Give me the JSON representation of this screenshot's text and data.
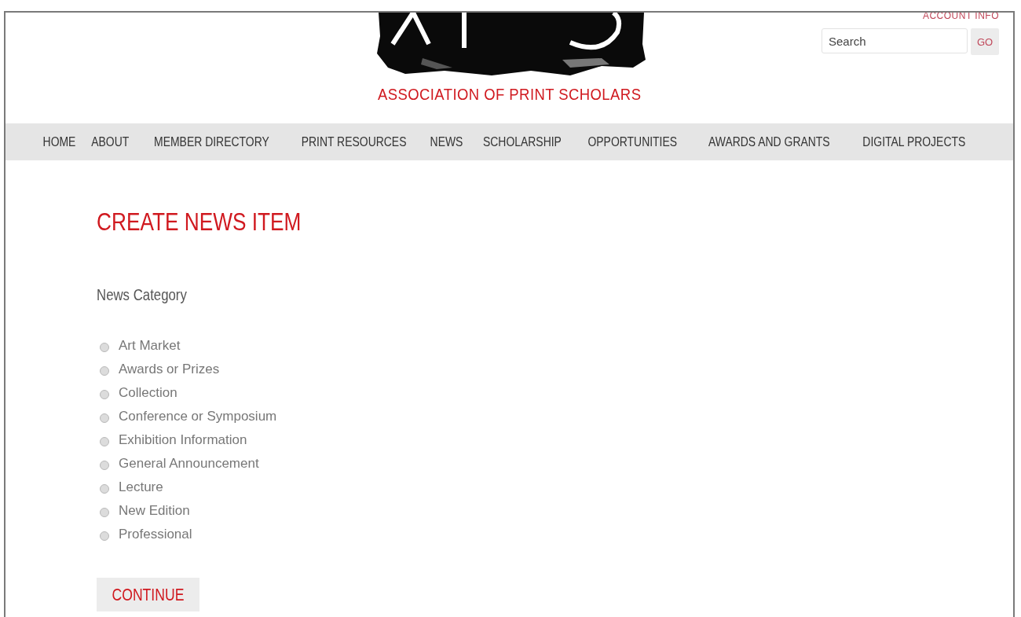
{
  "header": {
    "logo_caption": "ASSOCIATION OF PRINT SCHOLARS",
    "account_link": "ACCOUNT INFO",
    "search": {
      "placeholder": "Search",
      "button": "GO"
    }
  },
  "nav": [
    {
      "label": "HOME",
      "selected": false
    },
    {
      "label": "ABOUT",
      "selected": false
    },
    {
      "label": "MEMBER DIRECTORY",
      "selected": false
    },
    {
      "label": "PRINT RESOURCES",
      "selected": false
    },
    {
      "label": "NEWS",
      "selected": false
    },
    {
      "label": "SCHOLARSHIP",
      "selected": false
    },
    {
      "label": "OPPORTUNITIES",
      "selected": false
    },
    {
      "label": "AWARDS AND GRANTS",
      "selected": false
    },
    {
      "label": "DIGITAL PROJECTS",
      "selected": false
    }
  ],
  "page_title": "CREATE NEWS ITEM",
  "category": {
    "label": "News Category",
    "options": [
      {
        "label": "Art Market",
        "selected": false
      },
      {
        "label": "Awards or Prizes",
        "selected": false
      },
      {
        "label": "Collection",
        "selected": false
      },
      {
        "label": "Conference or Symposium",
        "selected": false
      },
      {
        "label": "Exhibition Information",
        "selected": false
      },
      {
        "label": "General Announcement",
        "selected": false
      },
      {
        "label": "Lecture",
        "selected": false
      },
      {
        "label": "New Edition",
        "selected": false
      },
      {
        "label": "Professional",
        "selected": false
      }
    ]
  },
  "continue_button": "CONTINUE"
}
